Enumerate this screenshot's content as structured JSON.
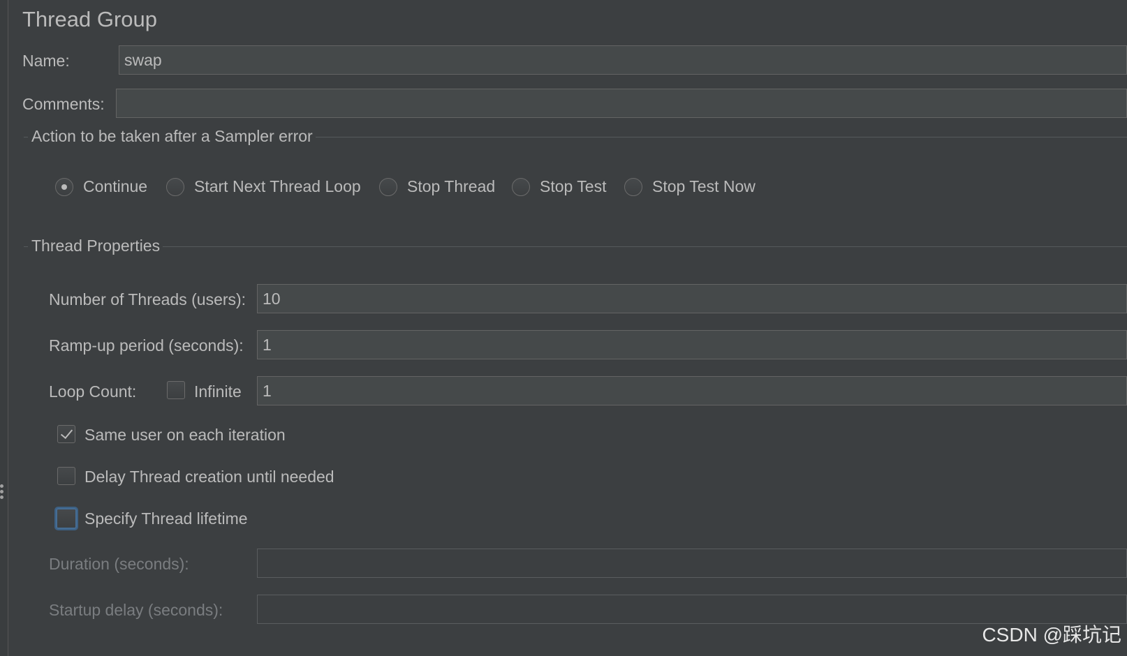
{
  "panel": {
    "title": "Thread Group",
    "name_label": "Name:",
    "name_value": "swap",
    "comments_label": "Comments:",
    "comments_value": ""
  },
  "sampler_error": {
    "group_title": "Action to be taken after a Sampler error",
    "options": [
      {
        "label": "Continue",
        "selected": true
      },
      {
        "label": "Start Next Thread Loop",
        "selected": false
      },
      {
        "label": "Stop Thread",
        "selected": false
      },
      {
        "label": "Stop Test",
        "selected": false
      },
      {
        "label": "Stop Test Now",
        "selected": false
      }
    ]
  },
  "thread_properties": {
    "group_title": "Thread Properties",
    "threads_label": "Number of Threads (users):",
    "threads_value": "10",
    "rampup_label": "Ramp-up period (seconds):",
    "rampup_value": "1",
    "loop_label": "Loop Count:",
    "infinite_label": "Infinite",
    "infinite_checked": false,
    "loop_value": "1",
    "same_user_label": "Same user on each iteration",
    "same_user_checked": true,
    "delay_label": "Delay Thread creation until needed",
    "delay_checked": false,
    "lifetime_label": "Specify Thread lifetime",
    "lifetime_checked": false,
    "duration_label": "Duration (seconds):",
    "duration_value": "",
    "startup_label": "Startup delay (seconds):",
    "startup_value": ""
  },
  "watermark": "CSDN @踩坑记"
}
